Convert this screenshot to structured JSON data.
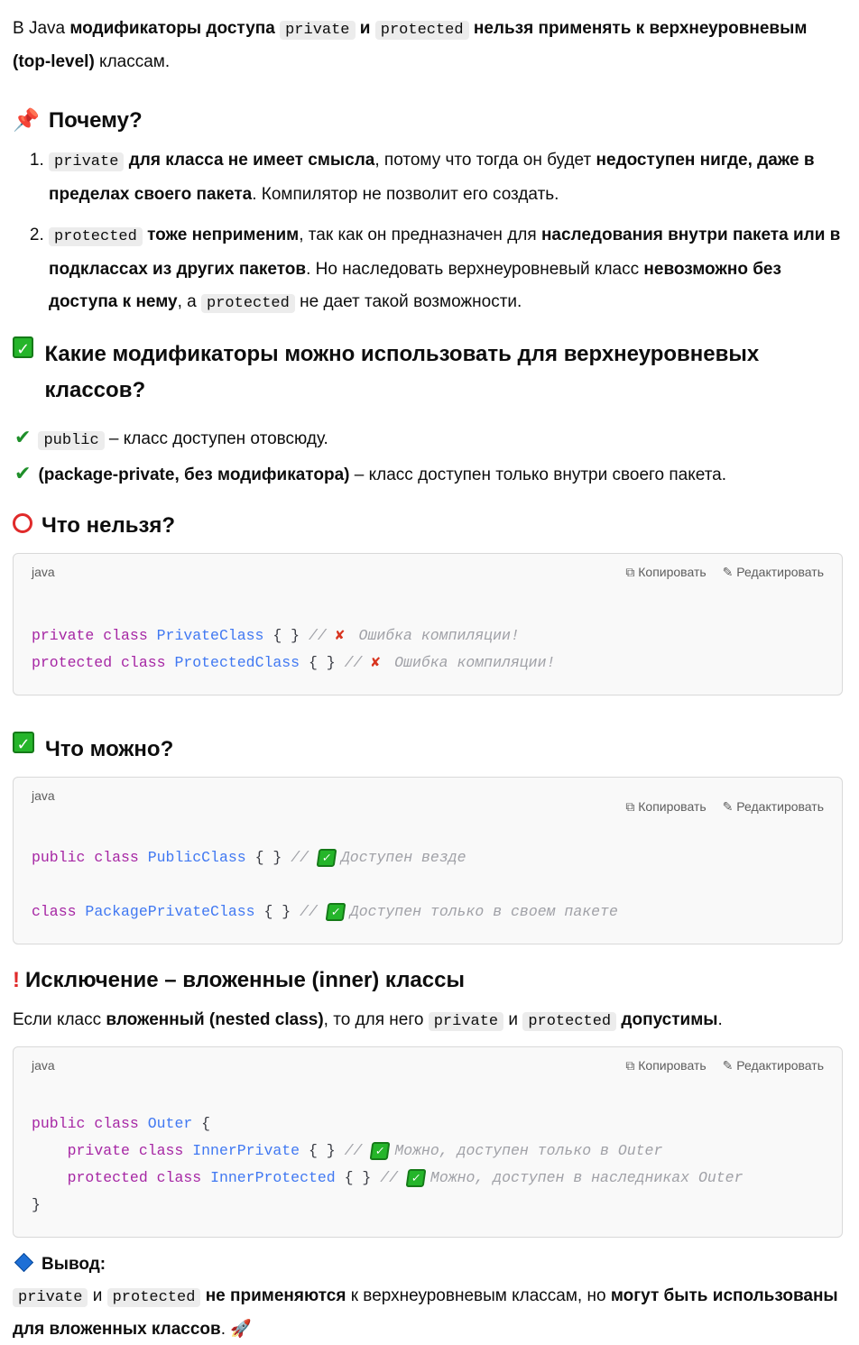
{
  "intro": [
    {
      "t": "В Java "
    },
    {
      "t": "модификаторы доступа ",
      "b": 1
    },
    {
      "t": "private",
      "c": 1
    },
    {
      "t": " и ",
      "b": 1
    },
    {
      "t": "protected",
      "c": 1
    },
    {
      "t": " нельзя применять к верхнеуровневым (top-level)",
      "b": 1
    },
    {
      "t": " классам."
    }
  ],
  "why": {
    "title": "Почему?",
    "items": [
      [
        {
          "t": "private",
          "c": 1
        },
        {
          "t": " для класса не имеет смысла",
          "b": 1
        },
        {
          "t": ", потому что тогда он будет "
        },
        {
          "t": "недоступен нигде, даже в пределах своего пакета",
          "b": 1
        },
        {
          "t": ". Компилятор не позволит его создать."
        }
      ],
      [
        {
          "t": "protected",
          "c": 1
        },
        {
          "t": " тоже неприменим",
          "b": 1
        },
        {
          "t": ", так как он предназначен для "
        },
        {
          "t": "наследования внутри пакета или в подклассах из других пакетов",
          "b": 1
        },
        {
          "t": ". Но наследовать верхнеуровневый класс "
        },
        {
          "t": "невозможно без доступа к нему",
          "b": 1
        },
        {
          "t": ", а "
        },
        {
          "t": "protected",
          "c": 1
        },
        {
          "t": " не дает такой возможности."
        }
      ]
    ]
  },
  "allowed": {
    "title": "Какие модификаторы можно использовать для верхнеуровневых классов?",
    "items": [
      [
        {
          "t": "public",
          "c": 1
        },
        {
          "t": " – класс доступен отовсюду."
        }
      ],
      [
        {
          "t": "(package-private, без модификатора)",
          "b": 1
        },
        {
          "t": " – класс доступен только внутри своего пакета."
        }
      ]
    ]
  },
  "cannot": {
    "title": "Что нельзя?",
    "lang": "java",
    "lines": [
      [
        {
          "t": "private",
          "k": "kw"
        },
        {
          "t": " "
        },
        {
          "t": "class",
          "k": "kw"
        },
        {
          "t": " "
        },
        {
          "t": "PrivateClass",
          "k": "cn"
        },
        {
          "t": " { } "
        },
        {
          "t": "// ",
          "k": "cm"
        },
        {
          "x": "cross"
        },
        {
          "t": "Ошибка компиляции!",
          "k": "cm"
        }
      ],
      [
        {
          "t": "protected",
          "k": "kw"
        },
        {
          "t": " "
        },
        {
          "t": "class",
          "k": "kw"
        },
        {
          "t": " "
        },
        {
          "t": "ProtectedClass",
          "k": "cn"
        },
        {
          "t": " { } "
        },
        {
          "t": "// ",
          "k": "cm"
        },
        {
          "x": "cross"
        },
        {
          "t": "Ошибка компиляции!",
          "k": "cm"
        }
      ]
    ]
  },
  "can": {
    "title": "Что можно?",
    "lang": "java",
    "lines": [
      [
        {
          "t": "public",
          "k": "kw"
        },
        {
          "t": " "
        },
        {
          "t": "class",
          "k": "kw"
        },
        {
          "t": " "
        },
        {
          "t": "PublicClass",
          "k": "cn"
        },
        {
          "t": " { } "
        },
        {
          "t": "// ",
          "k": "cm"
        },
        {
          "x": "check"
        },
        {
          "t": "Доступен везде",
          "k": "cm"
        }
      ],
      [],
      [
        {
          "t": "class",
          "k": "kw"
        },
        {
          "t": " "
        },
        {
          "t": "PackagePrivateClass",
          "k": "cn"
        },
        {
          "t": " { } "
        },
        {
          "t": "// ",
          "k": "cm"
        },
        {
          "x": "check"
        },
        {
          "t": "Доступен только в своем пакете",
          "k": "cm"
        }
      ]
    ]
  },
  "exception": {
    "title": "Исключение – вложенные (inner) классы",
    "text": [
      {
        "t": "Если класс "
      },
      {
        "t": "вложенный (nested class)",
        "b": 1
      },
      {
        "t": ", то для него "
      },
      {
        "t": "private",
        "c": 1
      },
      {
        "t": " и "
      },
      {
        "t": "protected",
        "c": 1
      },
      {
        "t": " "
      },
      {
        "t": "допустимы",
        "b": 1
      },
      {
        "t": "."
      }
    ],
    "lang": "java",
    "lines": [
      [
        {
          "t": "public",
          "k": "kw"
        },
        {
          "t": " "
        },
        {
          "t": "class",
          "k": "kw"
        },
        {
          "t": " "
        },
        {
          "t": "Outer",
          "k": "cn"
        },
        {
          "t": " {"
        }
      ],
      [
        {
          "t": "    "
        },
        {
          "t": "private",
          "k": "kw"
        },
        {
          "t": " "
        },
        {
          "t": "class",
          "k": "kw"
        },
        {
          "t": " "
        },
        {
          "t": "InnerPrivate",
          "k": "cn"
        },
        {
          "t": " { } "
        },
        {
          "t": "// ",
          "k": "cm"
        },
        {
          "x": "check"
        },
        {
          "t": "Можно, доступен только в Outer",
          "k": "cm"
        }
      ],
      [
        {
          "t": "    "
        },
        {
          "t": "protected",
          "k": "kw"
        },
        {
          "t": " "
        },
        {
          "t": "class",
          "k": "kw"
        },
        {
          "t": " "
        },
        {
          "t": "InnerProtected",
          "k": "cn"
        },
        {
          "t": " { } "
        },
        {
          "t": "// ",
          "k": "cm"
        },
        {
          "x": "check"
        },
        {
          "t": "Можно, доступен в наследниках Outer",
          "k": "cm"
        }
      ],
      [
        {
          "t": "}"
        }
      ]
    ]
  },
  "conclusion": {
    "title": "Вывод:",
    "text": [
      {
        "t": "private",
        "c": 1
      },
      {
        "t": " и "
      },
      {
        "t": "protected",
        "c": 1
      },
      {
        "t": " не применяются",
        "b": 1
      },
      {
        "t": " к верхнеуровневым классам, но "
      },
      {
        "t": "могут быть использованы для вложенных классов",
        "b": 1
      },
      {
        "t": ". "
      }
    ]
  },
  "code_actions": {
    "copy": "Копировать",
    "edit": "Редактировать"
  }
}
